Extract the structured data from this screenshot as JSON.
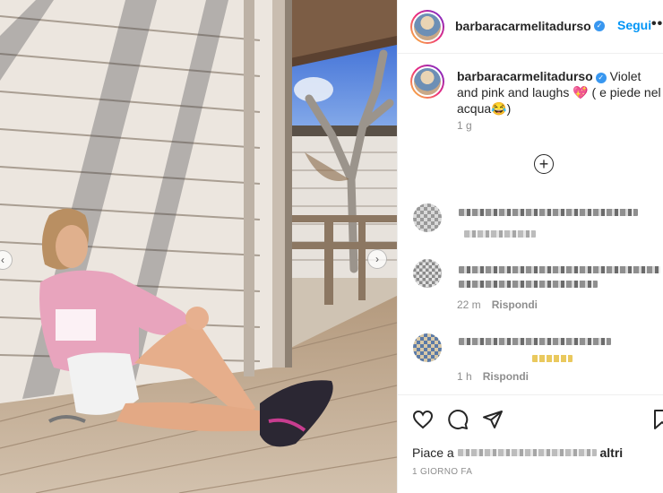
{
  "post": {
    "username": "barbaracarmelitadurso",
    "follow_label": "Segui",
    "more_label": "•••",
    "caption": {
      "username": "barbaracarmelitadurso",
      "text": " Violet and pink and laughs 💖 ( e piede nel acqua😂)",
      "time": "1 g"
    },
    "load_more_icon": "plus-circle-icon",
    "comments": [
      {
        "time": "",
        "reply_label": ""
      },
      {
        "time": "22 m",
        "reply_label": "Rispondi"
      },
      {
        "time": "1 h",
        "reply_label": "Rispondi"
      }
    ],
    "actions": {
      "like_icon": "heart-icon",
      "comment_icon": "comment-bubble-icon",
      "share_icon": "paper-plane-icon",
      "save_icon": "bookmark-icon"
    },
    "likes_prefix": "Piace a",
    "likes_suffix": "altri",
    "date": "1 GIORNO FA"
  },
  "colors": {
    "accent": "#0095f6",
    "verified": "#3897f0",
    "text": "#262626",
    "muted": "#8e8e8e",
    "border": "#efefef"
  }
}
